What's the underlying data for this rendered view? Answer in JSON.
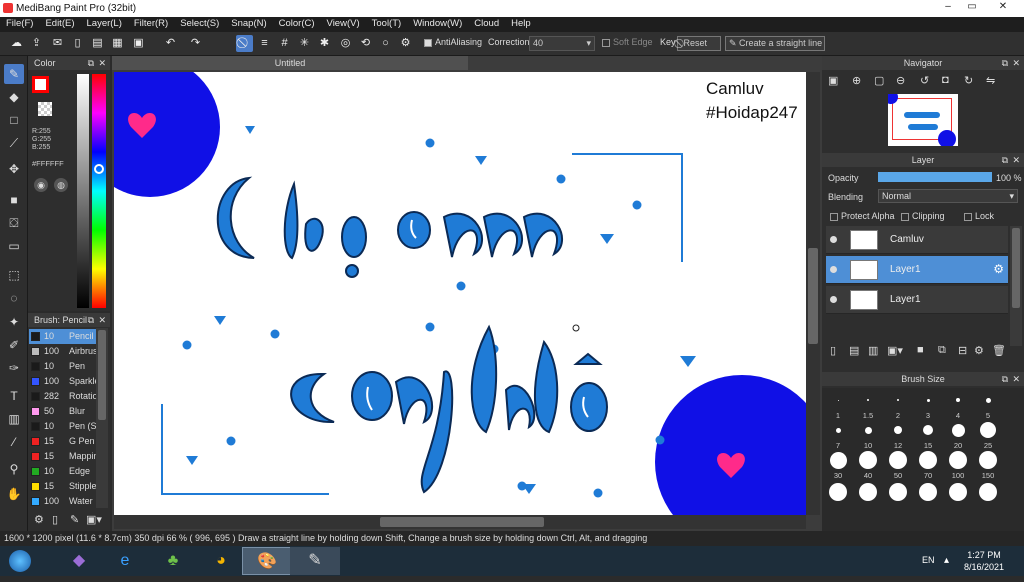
{
  "window": {
    "title": "MediBang Paint Pro (32bit)",
    "minimize": "–",
    "restore": "▭",
    "close": "✕"
  },
  "menu": [
    "File(F)",
    "Edit(E)",
    "Layer(L)",
    "Filter(R)",
    "Select(S)",
    "Snap(N)",
    "Color(C)",
    "View(V)",
    "Tool(T)",
    "Window(W)",
    "Cloud",
    "Help"
  ],
  "toolbar": {
    "antialiasing": "AntiAliasing",
    "correction_label": "Correction",
    "correction_value": "40",
    "soft_edge": "Soft Edge",
    "key_label": "Key",
    "reset": "Reset",
    "straight_line": "Create a straight line"
  },
  "color_panel": {
    "title": "Color",
    "r": "R:255",
    "g": "G:255",
    "b": "B:255",
    "hex": "#FFFFFF",
    "fg": "#ff0000",
    "bg": "#ffffff"
  },
  "brush_panel": {
    "title": "Brush: Pencil",
    "items": [
      {
        "size": "10",
        "name": "Pencil",
        "color": "#1a1a1a"
      },
      {
        "size": "100",
        "name": "Airbrush",
        "color": "#bbbbbb"
      },
      {
        "size": "10",
        "name": "Pen",
        "color": "#1a1a1a"
      },
      {
        "size": "100",
        "name": "Sparkle",
        "color": "#3355ff"
      },
      {
        "size": "282",
        "name": "Rotation",
        "color": "#1a1a1a"
      },
      {
        "size": "50",
        "name": "Blur",
        "color": "#ff99ee"
      },
      {
        "size": "10",
        "name": "Pen (S",
        "color": "#1a1a1a"
      },
      {
        "size": "15",
        "name": "G Pen",
        "color": "#ee2222"
      },
      {
        "size": "15",
        "name": "Mapping",
        "color": "#ee2222"
      },
      {
        "size": "10",
        "name": "Edge",
        "color": "#22aa22"
      },
      {
        "size": "15",
        "name": "Stipple",
        "color": "#ffdd00"
      },
      {
        "size": "100",
        "name": "Water",
        "color": "#33aaff"
      }
    ]
  },
  "document": {
    "tab": "Untitled"
  },
  "canvas_text": {
    "line1": "Camluv",
    "line2": "#Hoidap247"
  },
  "navigator": {
    "title": "Navigator"
  },
  "layer_panel": {
    "title": "Layer",
    "opacity_label": "Opacity",
    "opacity_value": "100 %",
    "opacity": 1.0,
    "blending_label": "Blending",
    "blending_value": "Normal",
    "protect_alpha": "Protect Alpha",
    "clipping": "Clipping",
    "lock": "Lock",
    "layers": [
      {
        "name": "Camluv",
        "selected": false
      },
      {
        "name": "Layer1",
        "selected": true
      },
      {
        "name": "Layer1",
        "selected": false
      }
    ]
  },
  "brush_size_panel": {
    "title": "Brush Size",
    "row1": [
      "1",
      "1.5",
      "2",
      "3",
      "4",
      "5"
    ],
    "row2": [
      "7",
      "10",
      "12",
      "15",
      "20",
      "25"
    ],
    "row3": [
      "30",
      "40",
      "50",
      "70",
      "100",
      "150"
    ]
  },
  "status": "1600 * 1200 pixel  (11.6 * 8.7cm)  350 dpi  66 %  ( 996, 695 )  Draw a straight line by holding down Shift, Change a brush size by holding down Ctrl, Alt, and dragging",
  "taskbar": {
    "lang": "EN",
    "time": "1:27 PM",
    "date": "8/16/2021"
  },
  "colors": {
    "accent": "#4b7cc8",
    "canvas_blue": "#1f7bd6",
    "circle_blue": "#1010e6",
    "heart_pink": "#ff2a8a"
  }
}
